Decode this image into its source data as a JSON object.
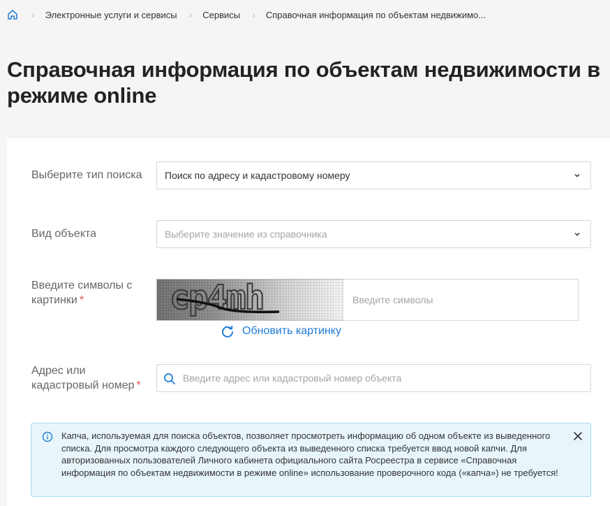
{
  "breadcrumb": {
    "home_icon": "home-icon",
    "items": [
      "Электронные услуги и сервисы",
      "Сервисы",
      "Справочная информация по объектам недвижимо..."
    ]
  },
  "page": {
    "title": "Справочная информация по объектам недвижимости в режиме online"
  },
  "form": {
    "search_type": {
      "label": "Выберите тип поиска",
      "value": "Поиск по адресу и кадастровому номеру"
    },
    "object_type": {
      "label": "Вид объекта",
      "placeholder": "Выберите значение из справочника"
    },
    "captcha": {
      "label": "Введите символы с картинки",
      "required_mark": "*",
      "image_text": "cp4mh",
      "input_placeholder": "Введите символы",
      "refresh_label": "Обновить картинку"
    },
    "address": {
      "label": "Адрес или кадастровый номер",
      "required_mark": "*",
      "placeholder": "Введите адрес или кадастровый номер объекта"
    }
  },
  "alert": {
    "text": "Капча, используемая для поиска объектов, позволяет просмотреть информацию об одном объекте из выведенного списка. Для просмотра каждого следующего объекта из выведенного списка требуется ввод новой капчи. Для авторизованных пользователей Личного кабинета официального сайта Росреестра в сервисе «Справочная информация по объектам недвижимости в режиме online» использование проверочного кода («капча») не требуется!"
  },
  "colors": {
    "accent": "#1f7bd6",
    "required": "#d9534f",
    "alert_bg": "#e8f6fb",
    "alert_border": "#a6dbee"
  }
}
